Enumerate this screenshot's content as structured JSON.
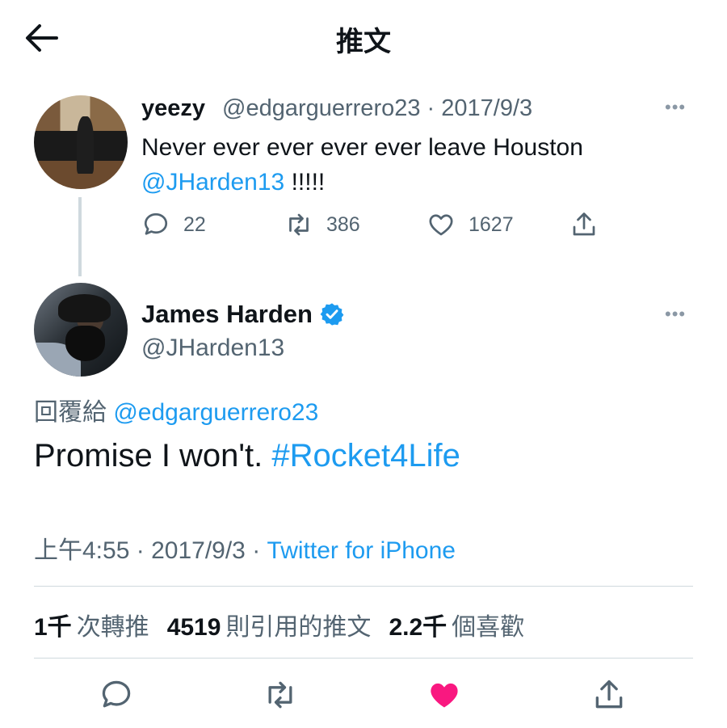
{
  "header": {
    "title": "推文"
  },
  "quoted_tweet": {
    "display_name": "yeezy",
    "handle": "@edgarguerrero23",
    "date_sep": "·",
    "date": "2017/9/3",
    "text_line1": "Never ever ever ever ever leave Houston",
    "mention": "@JHarden13",
    "text_suffix": "!!!!!",
    "replies": "22",
    "retweets": "386",
    "likes": "1627"
  },
  "main_tweet": {
    "display_name": "James Harden",
    "handle": "@JHarden13",
    "reply_prefix": "回覆給",
    "reply_handle": "@edgarguerrero23",
    "text": "Promise I won't.",
    "hashtag": "#Rocket4Life",
    "time": "上午4:55",
    "sep1": "·",
    "date": "2017/9/3",
    "sep2": "·",
    "source": "Twitter for iPhone"
  },
  "stats": {
    "retweets_count": "1千",
    "retweets_label": "次轉推",
    "quotes_count": "4519",
    "quotes_label": "則引用的推文",
    "likes_count": "2.2千",
    "likes_label": "個喜歡"
  },
  "colors": {
    "accent": "#1d9bf0",
    "like_active": "#f91880",
    "text_secondary": "#536471",
    "divider": "#cfd9de"
  },
  "icons": [
    "back-arrow-icon",
    "more-icon",
    "reply-icon",
    "retweet-icon",
    "like-icon",
    "share-icon",
    "verified-badge-icon"
  ]
}
